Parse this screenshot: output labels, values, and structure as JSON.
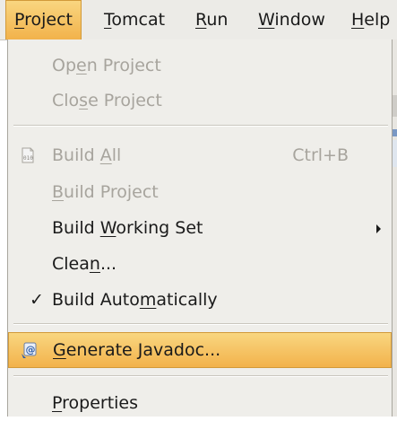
{
  "menubar": {
    "items": [
      {
        "label": "Project",
        "mnemonic_first": "P",
        "rest": "roject"
      },
      {
        "label": "Tomcat",
        "mnemonic_first": "T",
        "rest": "omcat"
      },
      {
        "label": "Run",
        "mnemonic_first": "R",
        "rest": "un"
      },
      {
        "label": "Window",
        "mnemonic_first": "W",
        "rest": "indow"
      },
      {
        "label": "Help",
        "mnemonic_first": "H",
        "rest": "elp"
      }
    ],
    "active": "Project"
  },
  "menu": {
    "open_project": {
      "pre": "Op",
      "u": "e",
      "post": "n Project"
    },
    "close_project": {
      "pre": "Clo",
      "u": "s",
      "post": "e Project"
    },
    "build_all": {
      "pre": "Build ",
      "u": "A",
      "post": "ll",
      "accel": "Ctrl+B",
      "icon": "build-binary-icon"
    },
    "build_project": {
      "pre": "",
      "u": "B",
      "post": "uild Project"
    },
    "build_working_set": {
      "pre": "Build ",
      "u": "W",
      "post": "orking Set"
    },
    "clean": {
      "pre": "Clea",
      "u": "n",
      "post": "..."
    },
    "build_automatically": {
      "pre": "Build Auto",
      "u": "m",
      "post": "atically",
      "checked": true
    },
    "generate_javadoc": {
      "pre": "",
      "u": "G",
      "post": "enerate Javadoc...",
      "icon": "javadoc-icon"
    },
    "properties": {
      "pre": "",
      "u": "P",
      "post": "roperties"
    }
  },
  "colors": {
    "highlight": "#f2b24b",
    "menu_bg": "#efeeea",
    "disabled_text": "#a7a49d"
  }
}
